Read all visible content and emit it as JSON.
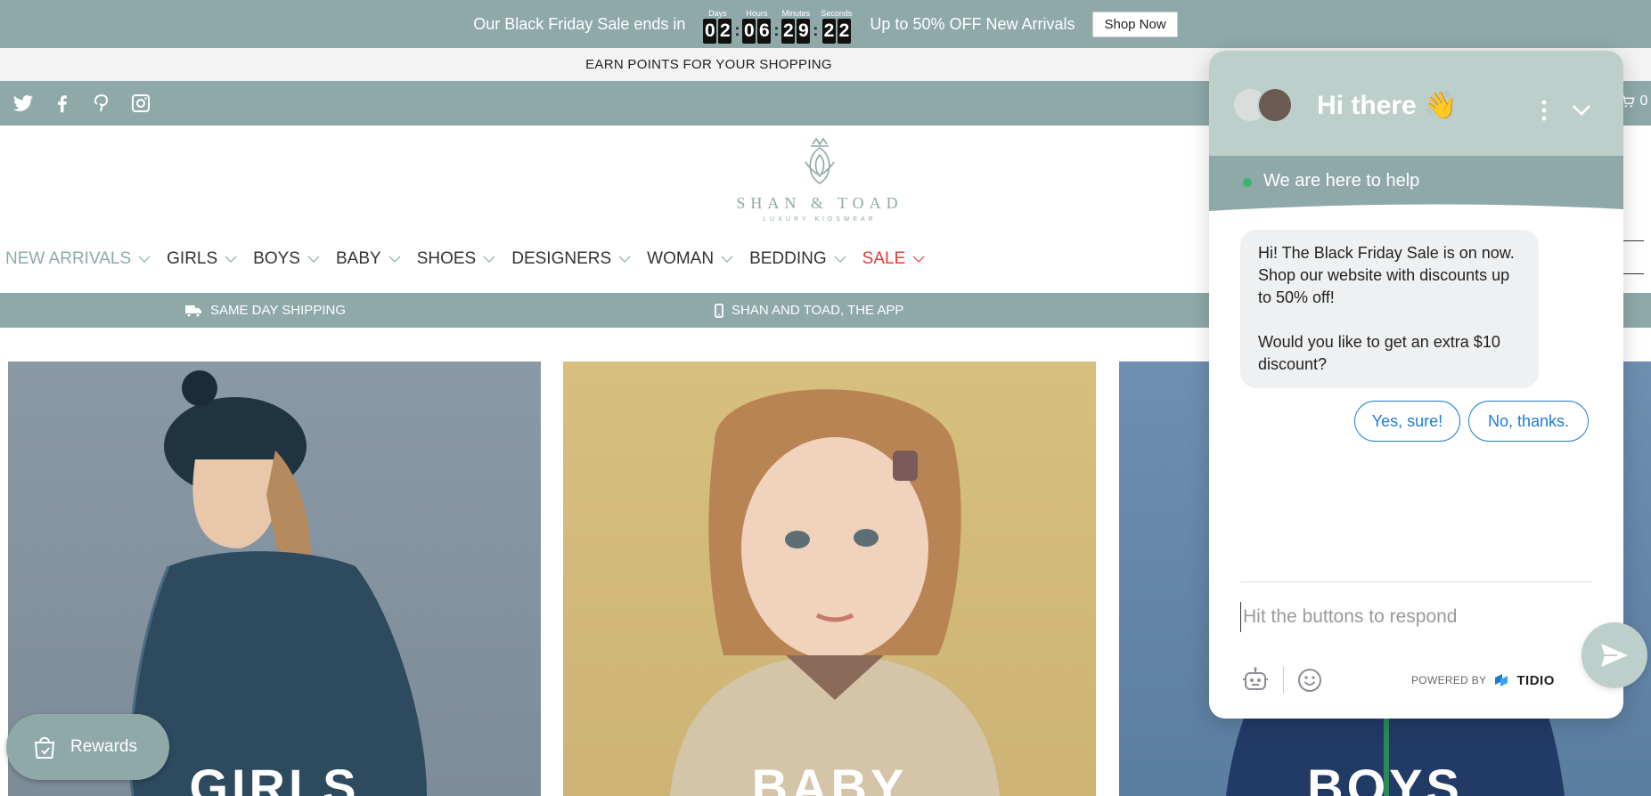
{
  "announcement": {
    "prefix": "Our Black Friday Sale ends in",
    "countdown": [
      {
        "label": "Days",
        "d1": "0",
        "d2": "2"
      },
      {
        "label": "Hours",
        "d1": "0",
        "d2": "6"
      },
      {
        "label": "Minutes",
        "d1": "2",
        "d2": "9"
      },
      {
        "label": "Seconds",
        "d1": "2",
        "d2": "2"
      }
    ],
    "separator": ":",
    "offer": "Up to 50% OFF New Arrivals",
    "cta": "Shop Now"
  },
  "points_bar": {
    "text": "EARN POINTS FOR YOUR SHOPPING"
  },
  "social": [
    "twitter-icon",
    "facebook-icon",
    "pinterest-icon",
    "instagram-icon"
  ],
  "header": {
    "brand": "SHAN & TOAD",
    "tagline": "LUXURY KIDSWEAR",
    "cart_count": "0"
  },
  "nav": [
    {
      "label": "NEW ARRIVALS"
    },
    {
      "label": "GIRLS"
    },
    {
      "label": "BOYS"
    },
    {
      "label": "BABY"
    },
    {
      "label": "SHOES"
    },
    {
      "label": "DESIGNERS"
    },
    {
      "label": "WOMAN"
    },
    {
      "label": "BEDDING"
    },
    {
      "label": "SALE"
    }
  ],
  "info_strip": {
    "shipping": "SAME DAY SHIPPING",
    "app": "SHAN AND TOAD, THE APP"
  },
  "tiles": [
    {
      "label": "GIRLS"
    },
    {
      "label": "BABY"
    },
    {
      "label": "BOYS"
    }
  ],
  "rewards": {
    "label": "Rewards"
  },
  "chat": {
    "title": "Hi there 👋",
    "status": "We are here to help",
    "message_p1": "Hi! The Black Friday Sale is on now. Shop our website with discounts up to 50% off!",
    "message_p2": "Would you like to get an extra $10 discount?",
    "quick_reply_yes": "Yes, sure!",
    "quick_reply_no": "No, thanks.",
    "input_placeholder": "Hit the buttons to respond",
    "powered_by": "POWERED BY",
    "powered_brand": "TIDIO"
  },
  "colors": {
    "brand_teal": "#8fa9a8",
    "chat_head": "#bccfcb",
    "sale_red": "#e03b3b",
    "link_blue": "#1e7bd8",
    "online_green": "#3bb46e"
  }
}
